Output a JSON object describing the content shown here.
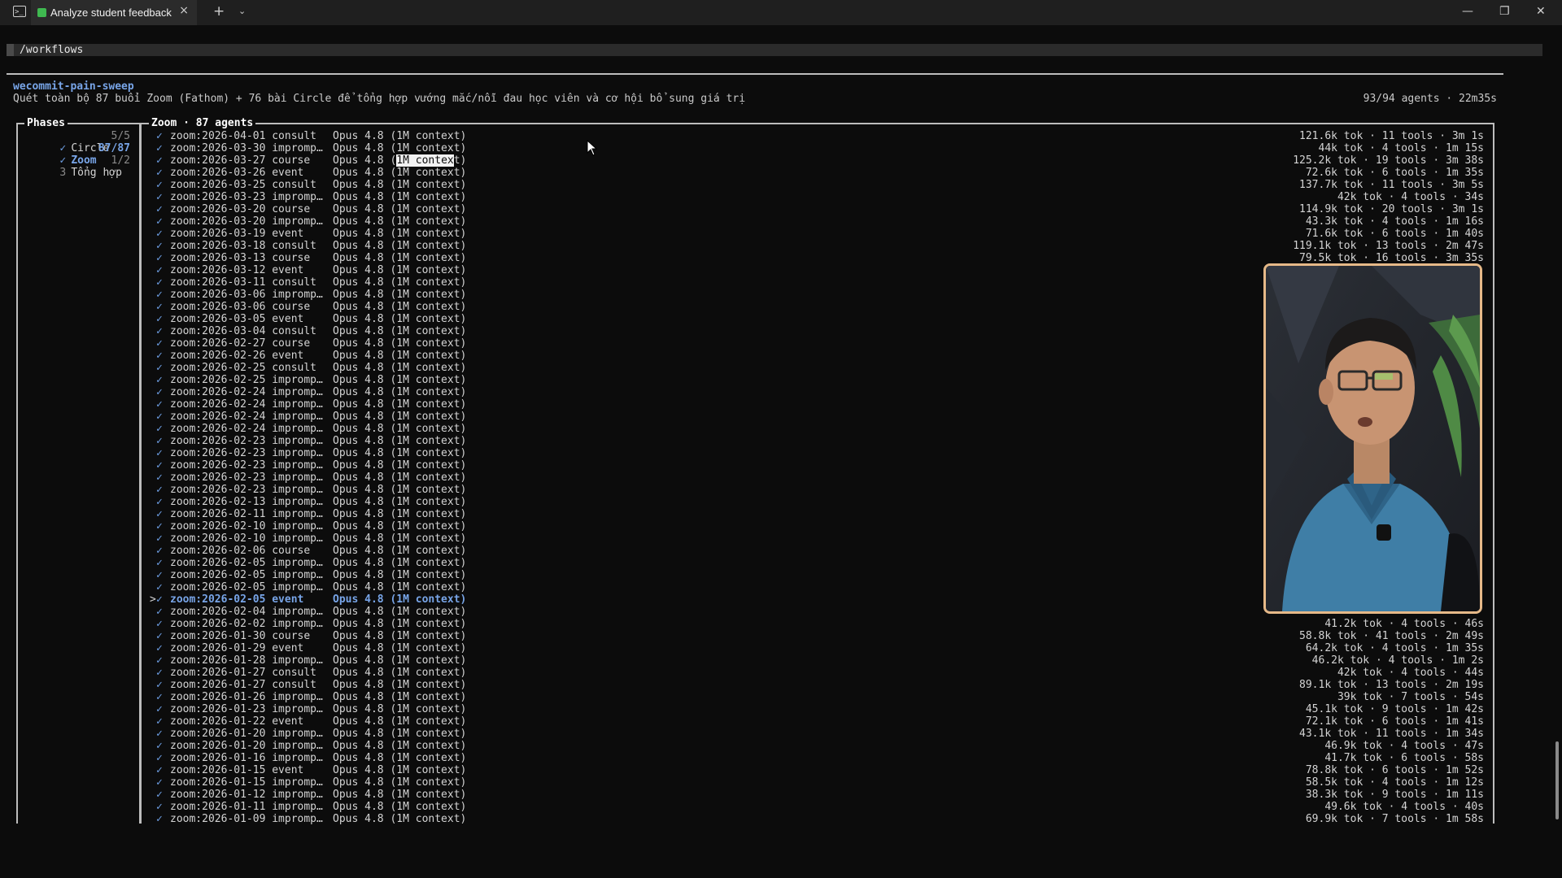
{
  "window": {
    "tab_title": "Analyze student feedback",
    "tab_close_icon": "×",
    "new_tab_icon": "+",
    "tab_dropdown_icon": "⌄",
    "minimize_icon": "—",
    "maximize_icon": "❐",
    "close_icon": "✕"
  },
  "path": "/workflows",
  "workflow": {
    "name": "wecommit-pain-sweep",
    "description": "Quét toàn bộ 87 buổi Zoom (Fathom) + 76 bài Circle để tổng hợp vướng mắc/nỗi đau học viên và cơ hội bổ sung giá trị",
    "stats": "93/94 agents · 22m35s"
  },
  "phases": {
    "title": "Phases",
    "items": [
      {
        "marker": "✓",
        "label": "Circle",
        "count": "5/5",
        "state": "done"
      },
      {
        "marker": "✓",
        "label": "Zoom",
        "count": "87/87",
        "state": "active"
      },
      {
        "marker": "3",
        "label": "Tổng hợp",
        "count": "1/2",
        "state": "pending"
      }
    ]
  },
  "agents": {
    "title": "Zoom · 87 agents",
    "check": "✓",
    "cursor": ">",
    "model": "Opus 4.8 (1M context)",
    "model_prefix": "Opus 4.8 (",
    "model_highlight": "1M contex",
    "model_suffix": "t)",
    "rows": [
      {
        "name": "zoom:2026-04-01 consult",
        "stats": "121.6k tok · 11 tools · 3m 1s"
      },
      {
        "name": "zoom:2026-03-30 impromp…",
        "stats": "44k tok · 4 tools · 1m 15s"
      },
      {
        "name": "zoom:2026-03-27 course",
        "stats": "125.2k tok · 19 tools · 3m 38s",
        "highlight": true
      },
      {
        "name": "zoom:2026-03-26 event",
        "stats": "72.6k tok · 6 tools · 1m 35s"
      },
      {
        "name": "zoom:2026-03-25 consult",
        "stats": "137.7k tok · 11 tools · 3m 5s"
      },
      {
        "name": "zoom:2026-03-23 impromp…",
        "stats": "42k tok · 4 tools · 34s"
      },
      {
        "name": "zoom:2026-03-20 course",
        "stats": "114.9k tok · 20 tools · 3m 1s"
      },
      {
        "name": "zoom:2026-03-20 impromp…",
        "stats": "43.3k tok · 4 tools · 1m 16s"
      },
      {
        "name": "zoom:2026-03-19 event",
        "stats": "71.6k tok · 6 tools · 1m 40s"
      },
      {
        "name": "zoom:2026-03-18 consult",
        "stats": "119.1k tok · 13 tools · 2m 47s"
      },
      {
        "name": "zoom:2026-03-13 course",
        "stats": "79.5k tok · 16 tools · 3m 35s"
      },
      {
        "name": "zoom:2026-03-12 event",
        "stats": ""
      },
      {
        "name": "zoom:2026-03-11 consult",
        "stats": ""
      },
      {
        "name": "zoom:2026-03-06 impromp…",
        "stats": ""
      },
      {
        "name": "zoom:2026-03-06 course",
        "stats": ""
      },
      {
        "name": "zoom:2026-03-05 event",
        "stats": ""
      },
      {
        "name": "zoom:2026-03-04 consult",
        "stats": ""
      },
      {
        "name": "zoom:2026-02-27 course",
        "stats": ""
      },
      {
        "name": "zoom:2026-02-26 event",
        "stats": ""
      },
      {
        "name": "zoom:2026-02-25 consult",
        "stats": ""
      },
      {
        "name": "zoom:2026-02-25 impromp…",
        "stats": ""
      },
      {
        "name": "zoom:2026-02-24 impromp…",
        "stats": ""
      },
      {
        "name": "zoom:2026-02-24 impromp…",
        "stats": ""
      },
      {
        "name": "zoom:2026-02-24 impromp…",
        "stats": ""
      },
      {
        "name": "zoom:2026-02-24 impromp…",
        "stats": ""
      },
      {
        "name": "zoom:2026-02-23 impromp…",
        "stats": ""
      },
      {
        "name": "zoom:2026-02-23 impromp…",
        "stats": ""
      },
      {
        "name": "zoom:2026-02-23 impromp…",
        "stats": ""
      },
      {
        "name": "zoom:2026-02-23 impromp…",
        "stats": ""
      },
      {
        "name": "zoom:2026-02-23 impromp…",
        "stats": ""
      },
      {
        "name": "zoom:2026-02-13 impromp…",
        "stats": ""
      },
      {
        "name": "zoom:2026-02-11 impromp…",
        "stats": ""
      },
      {
        "name": "zoom:2026-02-10 impromp…",
        "stats": ""
      },
      {
        "name": "zoom:2026-02-10 impromp…",
        "stats": ""
      },
      {
        "name": "zoom:2026-02-06 course",
        "stats": ""
      },
      {
        "name": "zoom:2026-02-05 impromp…",
        "stats": ""
      },
      {
        "name": "zoom:2026-02-05 impromp…",
        "stats": ""
      },
      {
        "name": "zoom:2026-02-05 impromp…",
        "stats": ""
      },
      {
        "name": "zoom:2026-02-05 event",
        "stats": "",
        "selected": true
      },
      {
        "name": "zoom:2026-02-04 impromp…",
        "stats": ""
      },
      {
        "name": "zoom:2026-02-02 impromp…",
        "stats": "41.2k tok · 4 tools · 46s"
      },
      {
        "name": "zoom:2026-01-30 course",
        "stats": "58.8k tok · 41 tools · 2m 49s"
      },
      {
        "name": "zoom:2026-01-29 event",
        "stats": "64.2k tok · 4 tools · 1m 35s"
      },
      {
        "name": "zoom:2026-01-28 impromp…",
        "stats": "46.2k tok · 4 tools · 1m 2s"
      },
      {
        "name": "zoom:2026-01-27 consult",
        "stats": "42k tok · 4 tools · 44s"
      },
      {
        "name": "zoom:2026-01-27 consult",
        "stats": "89.1k tok · 13 tools · 2m 19s"
      },
      {
        "name": "zoom:2026-01-26 impromp…",
        "stats": "39k tok · 7 tools · 54s"
      },
      {
        "name": "zoom:2026-01-23 impromp…",
        "stats": "45.1k tok · 9 tools · 1m 42s"
      },
      {
        "name": "zoom:2026-01-22 event",
        "stats": "72.1k tok · 6 tools · 1m 41s"
      },
      {
        "name": "zoom:2026-01-20 impromp…",
        "stats": "43.1k tok · 11 tools · 1m 34s"
      },
      {
        "name": "zoom:2026-01-20 impromp…",
        "stats": "46.9k tok · 4 tools · 47s"
      },
      {
        "name": "zoom:2026-01-16 impromp…",
        "stats": "41.7k tok · 6 tools · 58s"
      },
      {
        "name": "zoom:2026-01-15 event",
        "stats": "78.8k tok · 6 tools · 1m 52s"
      },
      {
        "name": "zoom:2026-01-15 impromp…",
        "stats": "58.5k tok · 4 tools · 1m 12s"
      },
      {
        "name": "zoom:2026-01-12 impromp…",
        "stats": "38.3k tok · 9 tools · 1m 11s"
      },
      {
        "name": "zoom:2026-01-11 impromp…",
        "stats": "49.6k tok · 4 tools · 40s"
      },
      {
        "name": "zoom:2026-01-09 impromp…",
        "stats": "69.9k tok · 7 tools · 1m 58s"
      }
    ]
  },
  "colors": {
    "accent_blue": "#78a5e8",
    "check_blue": "#6fa0e6",
    "background": "#0c0c0c",
    "webcam_border": "#e6b988",
    "tab_status": "#3fb950"
  }
}
